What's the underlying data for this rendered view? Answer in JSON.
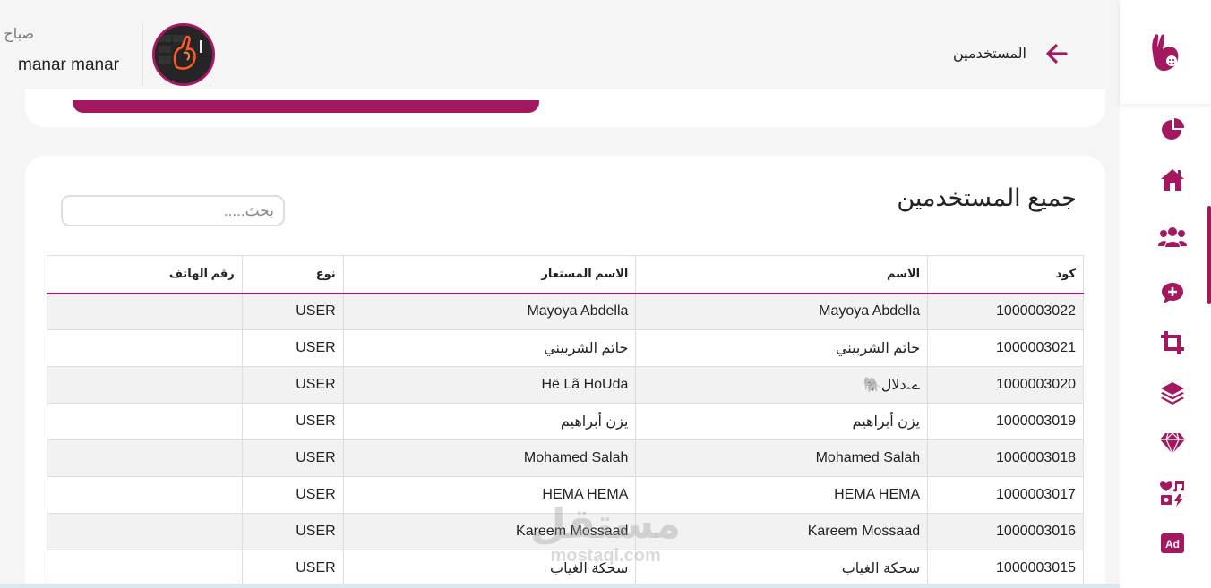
{
  "header": {
    "greeting": "صباح الخير",
    "user_name": "manar manar",
    "page_title": "المستخدمين"
  },
  "main": {
    "card_title": "جميع المستخدمين",
    "search_placeholder": "بحث.....",
    "columns": [
      "كود",
      "الاسم",
      "الاسم المستعار",
      "نوع",
      "رقم الهاتف"
    ],
    "rows": [
      {
        "code": "1000003022",
        "name": "Mayoya Abdella",
        "nickname": "Mayoya Abdella",
        "type": "USER",
        "phone": ""
      },
      {
        "code": "1000003021",
        "name": "حاتم الشربيني",
        "nickname": "حاتم الشربيني",
        "type": "USER",
        "phone": ""
      },
      {
        "code": "1000003020",
        "name": "ےۦدلال🐘",
        "nickname": "Hë Lã HoUda",
        "type": "USER",
        "phone": ""
      },
      {
        "code": "1000003019",
        "name": "يزن أبراهيم",
        "nickname": "يزن أبراهيم",
        "type": "USER",
        "phone": ""
      },
      {
        "code": "1000003018",
        "name": "Mohamed Salah",
        "nickname": "Mohamed Salah",
        "type": "USER",
        "phone": ""
      },
      {
        "code": "1000003017",
        "name": "HEMA HEMA",
        "nickname": "HEMA HEMA",
        "type": "USER",
        "phone": ""
      },
      {
        "code": "1000003016",
        "name": "Kareem Mossaad",
        "nickname": "Kareem Mossaad",
        "type": "USER",
        "phone": ""
      },
      {
        "code": "1000003015",
        "name": "سحكة الغياب",
        "nickname": "سحكة الغياب",
        "type": "USER",
        "phone": ""
      }
    ]
  },
  "sidebar": {
    "icons": [
      "hand-logo-icon",
      "pie-chart-icon",
      "home-icon",
      "users-icon",
      "comment-plus-icon",
      "crop-icon",
      "layers-icon",
      "gem-icon",
      "icons-icon",
      "ad-icon"
    ]
  },
  "watermark": {
    "arabic": "مستقل",
    "latin": "mostaql.com"
  },
  "colors": {
    "accent": "#a3185f",
    "table_border_accent": "#b2176a",
    "row_alt": "#f2f2f2"
  }
}
